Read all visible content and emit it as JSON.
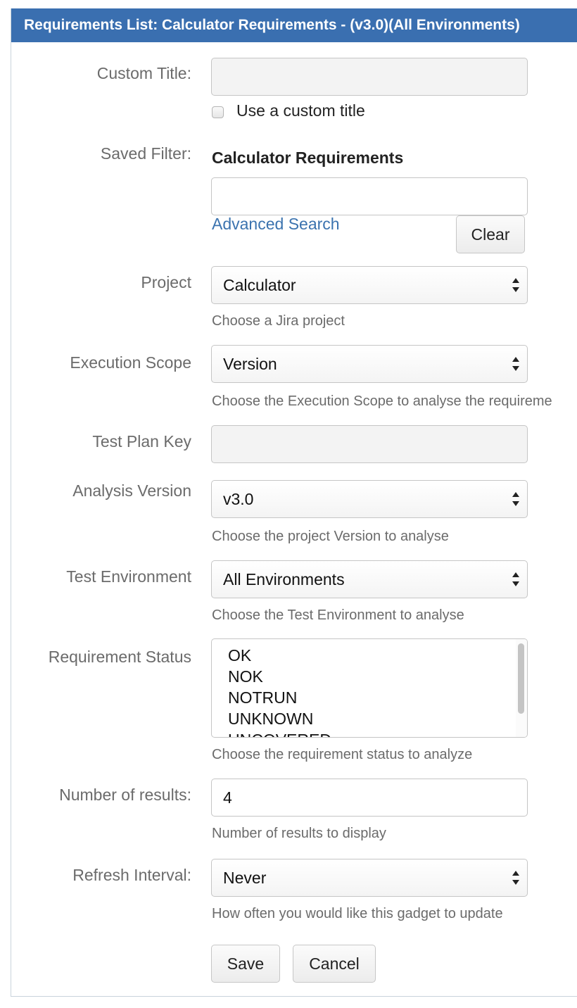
{
  "header": {
    "title": "Requirements List: Calculator Requirements - (v3.0)(All Environments)"
  },
  "custom_title": {
    "label": "Custom Title:",
    "value": "",
    "checkbox_label": "Use a custom title"
  },
  "saved_filter": {
    "label": "Saved Filter:",
    "name": "Calculator Requirements",
    "value": "",
    "advanced_search": "Advanced Search",
    "clear": "Clear"
  },
  "project": {
    "label": "Project",
    "selected": "Calculator",
    "help": "Choose a Jira project"
  },
  "execution_scope": {
    "label": "Execution Scope",
    "selected": "Version",
    "help": "Choose the Execution Scope to analyse the requireme"
  },
  "test_plan_key": {
    "label": "Test Plan Key",
    "value": ""
  },
  "analysis_version": {
    "label": "Analysis Version",
    "selected": "v3.0",
    "help": "Choose the project Version to analyse"
  },
  "test_environment": {
    "label": "Test Environment",
    "selected": "All Environments",
    "help": "Choose the Test Environment to analyse"
  },
  "requirement_status": {
    "label": "Requirement Status",
    "options": [
      "OK",
      "NOK",
      "NOTRUN",
      "UNKNOWN",
      "UNCOVERED"
    ],
    "help": "Choose the requirement status to analyze"
  },
  "number_of_results": {
    "label": "Number of results:",
    "value": "4",
    "help": "Number of results to display"
  },
  "refresh_interval": {
    "label": "Refresh Interval:",
    "selected": "Never",
    "help": "How often you would like this gadget to update"
  },
  "buttons": {
    "save": "Save",
    "cancel": "Cancel"
  },
  "colors": {
    "header_bg": "#3a6fb0",
    "link": "#3b73af"
  }
}
